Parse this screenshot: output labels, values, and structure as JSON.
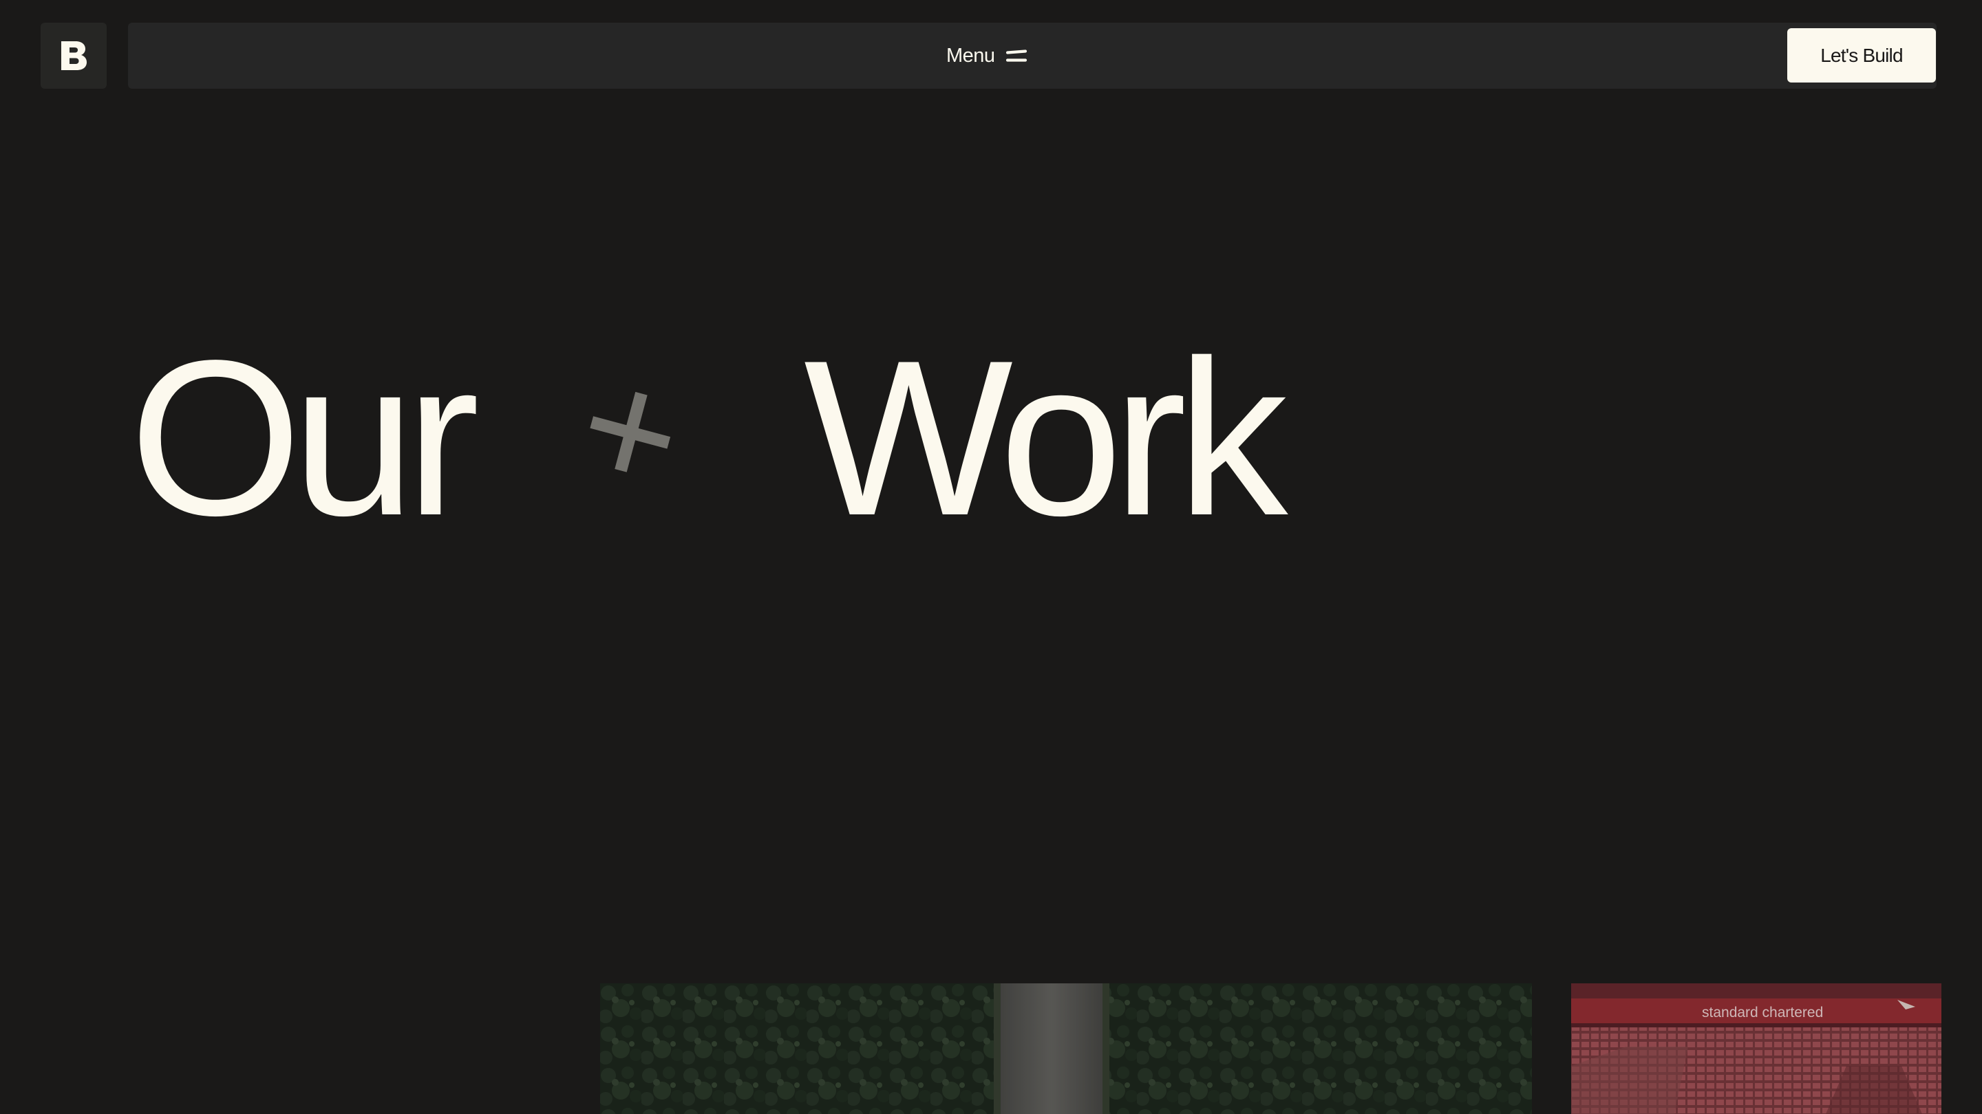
{
  "header": {
    "logo_letter": "B",
    "menu_label": "Menu",
    "menu_icon": "hamburger-icon",
    "cta_label": "Let's Build"
  },
  "hero": {
    "word_left": "Our",
    "word_right": "Work",
    "separator_icon": "plus-icon"
  },
  "projects": [
    {
      "image": "aerial-forest-road-image"
    },
    {
      "image": "stadium-seating-image",
      "banner_text": "standard chartered"
    }
  ],
  "colors": {
    "background": "#1a1918",
    "navbar": "#262626",
    "cream": "#fcf9ee",
    "plus_grey": "#74736e",
    "stadium_red": "#a5323c"
  }
}
